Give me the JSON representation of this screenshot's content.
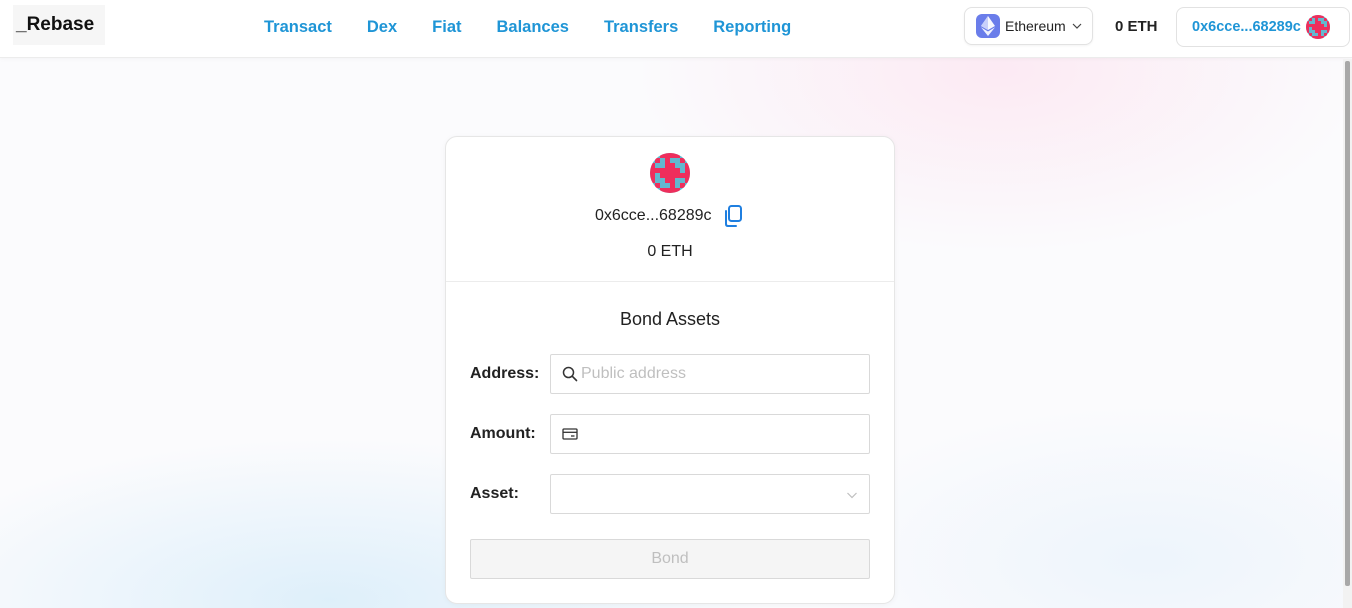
{
  "app": {
    "logo": "_Rebase"
  },
  "nav": {
    "items": [
      {
        "label": "Transact"
      },
      {
        "label": "Dex"
      },
      {
        "label": "Fiat"
      },
      {
        "label": "Balances"
      },
      {
        "label": "Transfers"
      },
      {
        "label": "Reporting"
      }
    ]
  },
  "header": {
    "network": "Ethereum",
    "balance": "0 ETH",
    "account_address": "0x6cce...68289c"
  },
  "wallet": {
    "address": "0x6cce...68289c",
    "balance": "0 ETH"
  },
  "form": {
    "title": "Bond Assets",
    "address_label": "Address:",
    "address_placeholder": "Public address",
    "address_value": "",
    "amount_label": "Amount:",
    "amount_value": "",
    "asset_label": "Asset:",
    "asset_value": "",
    "submit_label": "Bond"
  },
  "colors": {
    "accent": "#1f95d6",
    "avatar_primary": "#ee2e5c",
    "avatar_secondary": "#62b8cf",
    "ethereum": "#6a7dea"
  },
  "icons": {
    "network": "ethereum-icon",
    "copy": "copy-icon",
    "address_prefix": "search-icon",
    "amount_prefix": "credit-card-icon",
    "select_arrow": "chevron-down-icon"
  }
}
